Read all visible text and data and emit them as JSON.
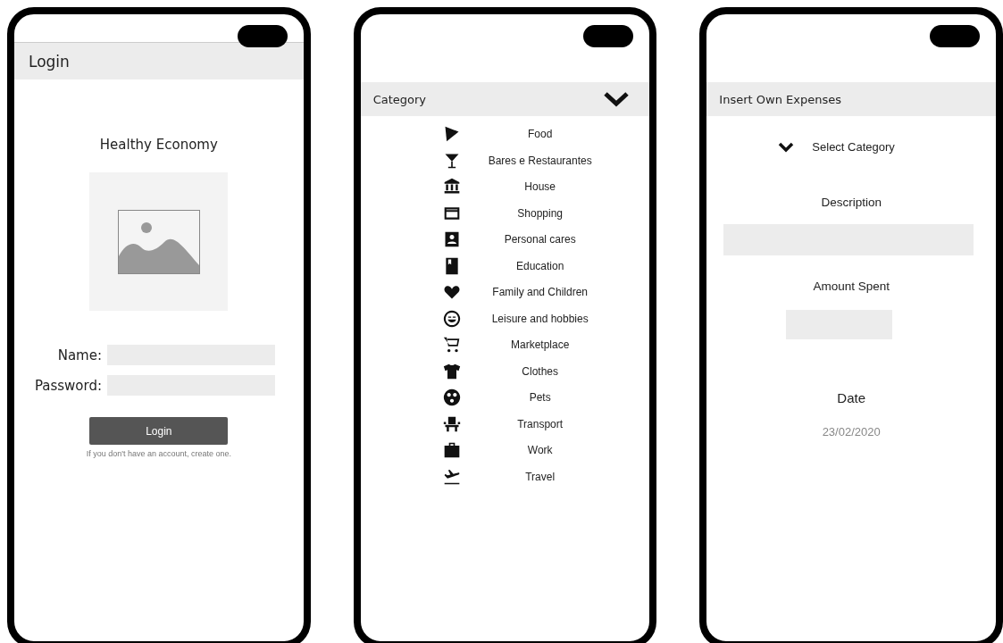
{
  "login_screen": {
    "header": "Login",
    "app_title": "Healthy Economy",
    "fields": [
      {
        "label": "Name:"
      },
      {
        "label": "Password:"
      }
    ],
    "login_button": "Login",
    "hint": "If you don't have an account, create one."
  },
  "category_screen": {
    "header": "Category",
    "categories": [
      {
        "label": "Food"
      },
      {
        "label": "Bares e Restaurantes"
      },
      {
        "label": "House"
      },
      {
        "label": "Shopping"
      },
      {
        "label": "Personal cares"
      },
      {
        "label": "Education"
      },
      {
        "label": "Family and Children"
      },
      {
        "label": "Leisure and hobbies"
      },
      {
        "label": "Marketplace"
      },
      {
        "label": "Clothes"
      },
      {
        "label": "Pets"
      },
      {
        "label": "Transport"
      },
      {
        "label": "Work"
      },
      {
        "label": "Travel"
      }
    ]
  },
  "expense_screen": {
    "header": "Insert Own Expenses",
    "select": "Select Category",
    "description_label": "Description",
    "amount_label": "Amount Spent",
    "date_label": "Date",
    "date_value": "23/02/2020"
  }
}
